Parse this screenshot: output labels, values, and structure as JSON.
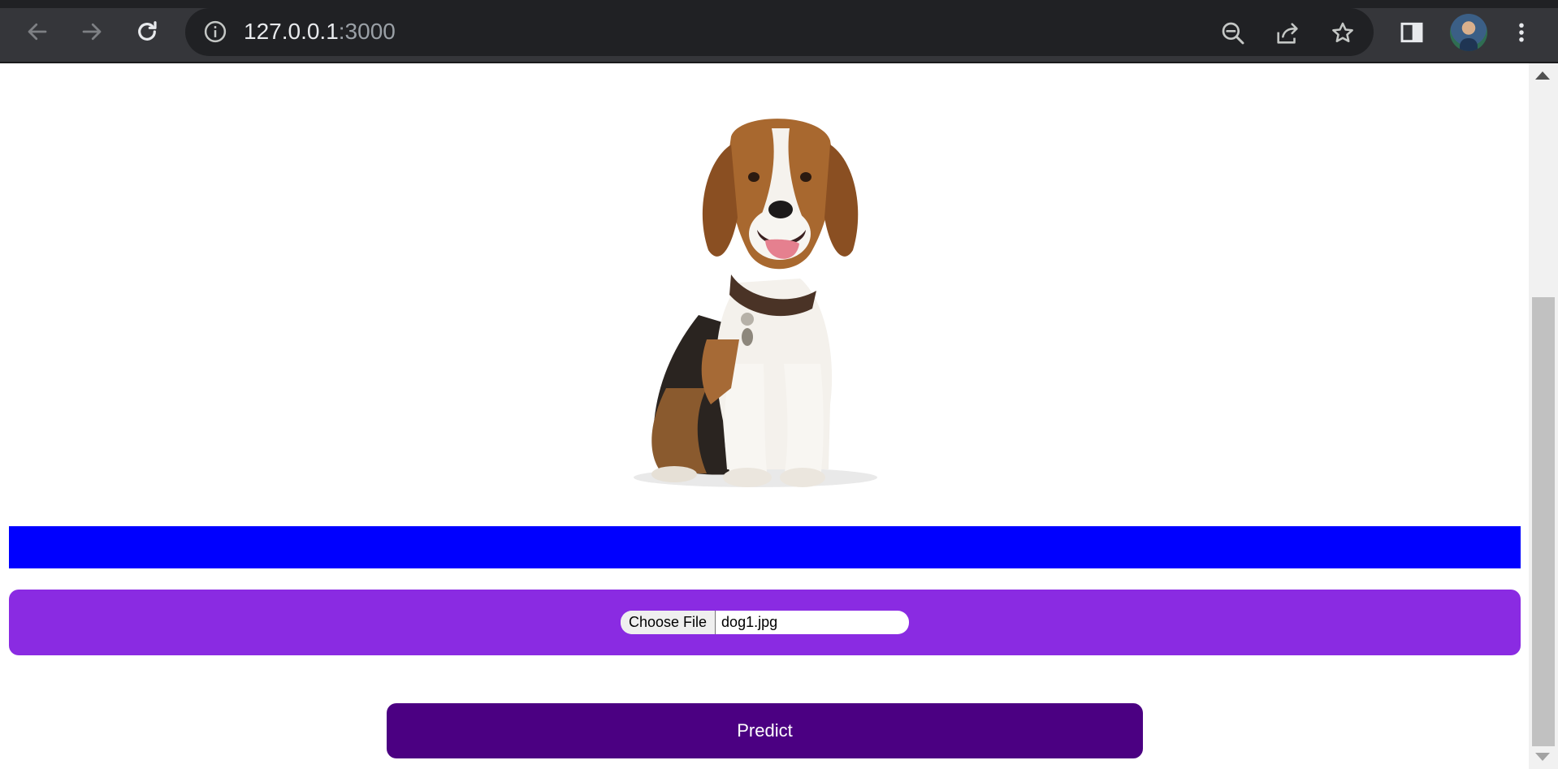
{
  "browser": {
    "url_host": "127.0.0.1",
    "url_port": ":3000",
    "icons": {
      "back": "arrow-left-icon",
      "forward": "arrow-right-icon",
      "reload": "reload-icon",
      "site_info": "info-icon",
      "zoom": "zoom-out-icon",
      "share": "share-icon",
      "bookmark": "star-icon",
      "side_panel": "side-panel-icon",
      "menu": "kebab-menu-icon"
    }
  },
  "page": {
    "image_subject": "beagle dog sitting",
    "result_bar_color": "#0000ff",
    "upload_panel_color": "#8a2be2",
    "predict_color": "#4b0082",
    "file_input": {
      "button_label": "Choose File",
      "file_name": "dog1.jpg"
    },
    "predict_label": "Predict"
  }
}
